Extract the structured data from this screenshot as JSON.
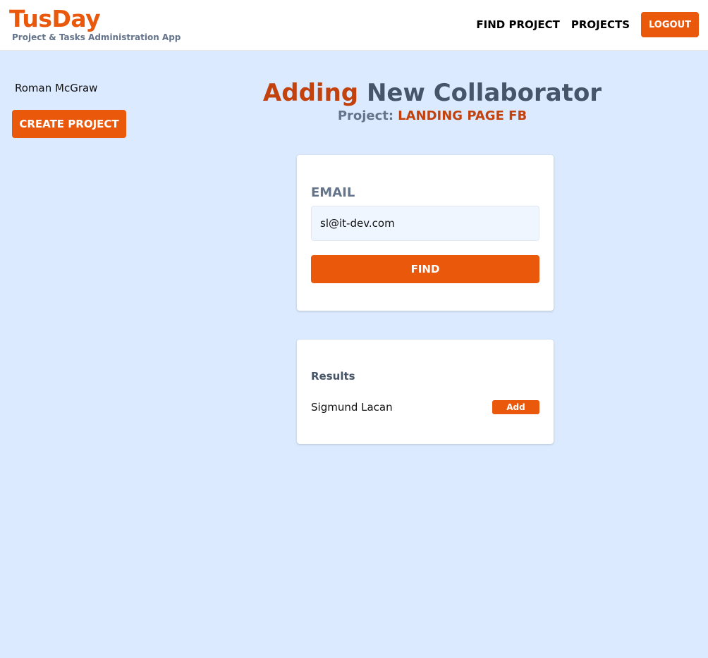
{
  "header": {
    "brand_title": "TusDay",
    "brand_subtitle": "Project & Tasks Administration App",
    "nav": {
      "find_project": "FIND PROJECT",
      "projects": "PROJECTS",
      "logout": "LOGOUT"
    }
  },
  "sidebar": {
    "user_name": "Roman McGraw",
    "create_project_label": "CREATE PROJECT"
  },
  "main": {
    "title_accent": "Adding",
    "title_rest": "New Collaborator",
    "project_label": "Project:",
    "project_name": "LANDING PAGE FB"
  },
  "form": {
    "email_label": "EMAIL",
    "email_value": "sl@it-dev.com",
    "find_label": "FIND"
  },
  "results": {
    "title": "Results",
    "items": [
      {
        "name": "Sigmund Lacan",
        "action_label": "Add"
      }
    ]
  },
  "colors": {
    "accent": "#ea580c",
    "accent_dark": "#c2410c",
    "background": "#dbeafe",
    "slate": "#475569"
  }
}
